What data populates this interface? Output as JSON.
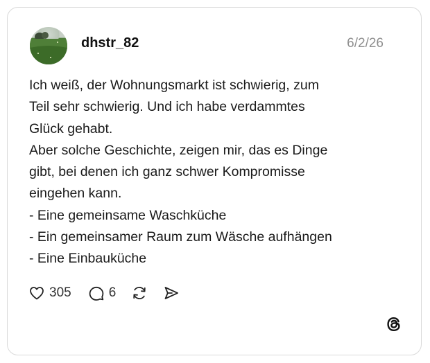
{
  "post": {
    "username": "dhstr_82",
    "date": "6/2/26",
    "lines": [
      "Ich weiß, der Wohnungsmarkt ist schwierig, zum",
      "Teil sehr schwierig. Und ich habe verdammtes",
      "Glück gehabt.",
      "Aber solche Geschichte, zeigen mir, das es Dinge",
      "gibt, bei denen ich ganz schwer Kompromisse",
      "eingehen kann.",
      "- Eine gemeinsame Waschküche",
      "- Ein gemeinsamer Raum zum Wäsche aufhängen",
      "- Eine Einbauküche"
    ],
    "likes": "305",
    "replies": "6"
  },
  "icons": {
    "avatar": "profile-photo",
    "like": "heart-icon",
    "reply": "comment-icon",
    "repost": "repost-icon",
    "share": "send-icon",
    "brand": "threads-logo"
  }
}
